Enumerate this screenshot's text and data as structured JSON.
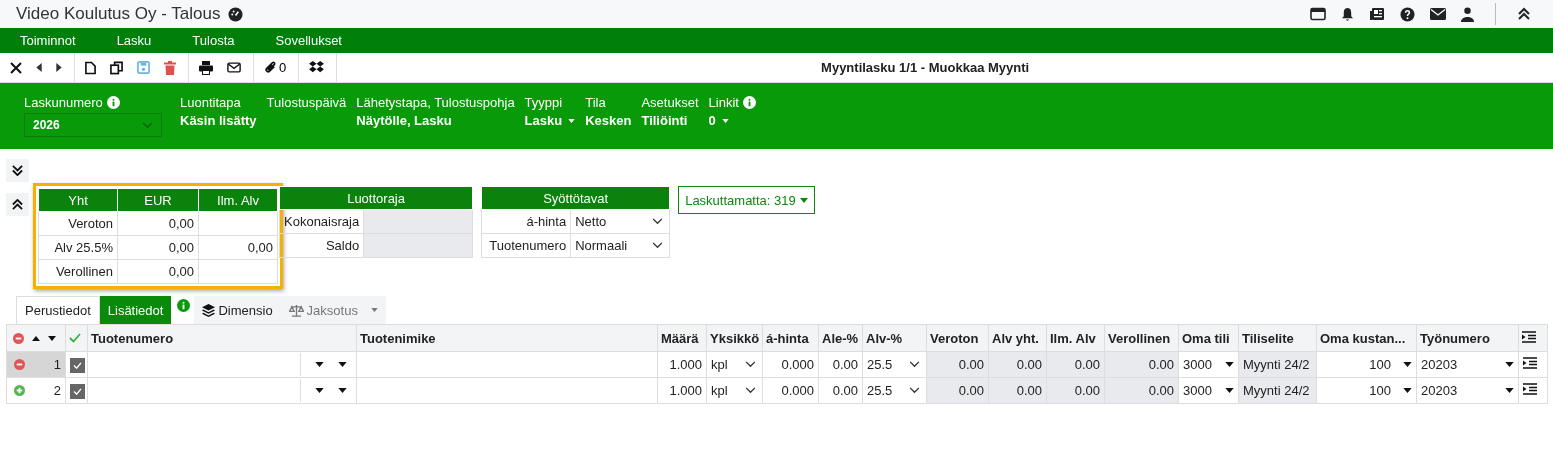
{
  "app_title": "Video Koulutus Oy - Talous",
  "menu": [
    "Toiminnot",
    "Lasku",
    "Tulosta",
    "Sovellukset"
  ],
  "toolbar": {
    "attachments": "0",
    "document_title": "Myyntilasku 1/1 - Muokkaa Myynti"
  },
  "header_fields": [
    {
      "label": "Laskunumero",
      "value": "2026",
      "kind": "select",
      "info": true
    },
    {
      "label": "Luontitapa",
      "value": "Käsin lisätty",
      "kind": "text"
    },
    {
      "label": "Tulostuspäivä",
      "kind": "text"
    },
    {
      "label": "Lähetystapa, Tulostuspohja",
      "value": "Näytölle, Lasku",
      "kind": "text"
    },
    {
      "label": "Tyyppi",
      "value": "Lasku",
      "kind": "dropdown"
    },
    {
      "label": "Tila",
      "value": "Kesken",
      "kind": "text"
    },
    {
      "label": "Asetukset",
      "value": "Tiliöinti",
      "kind": "text"
    },
    {
      "label": "Linkit",
      "value": "0",
      "kind": "dropdown",
      "info": true
    }
  ],
  "totals": {
    "columns": [
      "Yht",
      "EUR",
      "Ilm. Alv"
    ],
    "rows": [
      [
        "Veroton",
        "0,00",
        null
      ],
      [
        "Alv 25.5%",
        "0,00",
        "0,00"
      ],
      [
        "Verollinen",
        "0,00",
        null
      ]
    ]
  },
  "credit": {
    "title": "Luottoraja",
    "rows": [
      "Kokonaisraja",
      "Saldo"
    ]
  },
  "input_modes": {
    "title": "Syöttötavat",
    "rows": [
      {
        "label": "á-hinta",
        "value": "Netto"
      },
      {
        "label": "Tuotenumero",
        "value": "Normaali"
      }
    ]
  },
  "unbilled": "Laskuttamatta: 319",
  "tabs": [
    {
      "label": "Perustiedot",
      "selected": true,
      "kind": "plain"
    },
    {
      "label": "Lisätiedot",
      "selected": false,
      "kind": "accent"
    },
    {
      "label": "Dimensio",
      "selected": false,
      "kind": "layers"
    },
    {
      "label": "Jaksotus",
      "selected": false,
      "kind": "scale"
    }
  ],
  "table": {
    "columns": [
      {
        "label": "Tuotenumero",
        "kind": "lookup"
      },
      {
        "label": "Tuotenimike",
        "kind": "text"
      },
      {
        "label": "Määrä",
        "kind": "num"
      },
      {
        "label": "Yksikkö",
        "kind": "select"
      },
      {
        "label": "á-hinta",
        "kind": "num"
      },
      {
        "label": "Ale-%",
        "kind": "num"
      },
      {
        "label": "Alv-%",
        "kind": "select"
      },
      {
        "label": "Veroton",
        "kind": "readonly"
      },
      {
        "label": "Alv yht.",
        "kind": "readonly"
      },
      {
        "label": "Ilm. Alv",
        "kind": "readonly"
      },
      {
        "label": "Verollinen",
        "kind": "readonly"
      },
      {
        "label": "Oma tili",
        "kind": "dropdown"
      },
      {
        "label": "Tiliselite",
        "kind": "readtext"
      },
      {
        "label": "Oma kustan...",
        "kind": "dropnum"
      },
      {
        "label": "Työnumero",
        "kind": "dropdown"
      }
    ],
    "rows": [
      {
        "number": "1",
        "checked": true,
        "kind": "remove",
        "selected": true,
        "cells": [
          null,
          null,
          "1.000",
          "kpl",
          "0.000",
          "0.00",
          "25.5",
          "0.00",
          "0.00",
          "0.00",
          "0.00",
          "3000",
          "Myynti 24/2",
          "100",
          "20203"
        ]
      },
      {
        "number": "2",
        "checked": true,
        "kind": "add",
        "selected": false,
        "cells": [
          null,
          null,
          "1.000",
          "kpl",
          "0.000",
          "0.00",
          "25.5",
          "0.00",
          "0.00",
          "0.00",
          "0.00",
          "3000",
          "Myynti 24/2",
          "100",
          "20203"
        ]
      }
    ]
  }
}
